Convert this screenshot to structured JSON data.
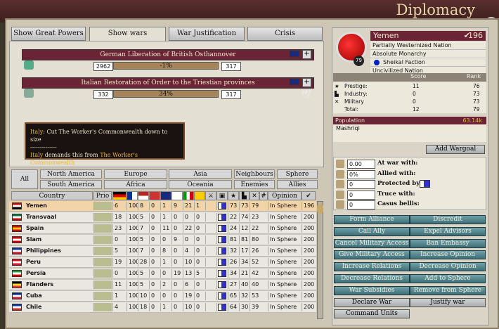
{
  "window": {
    "title": "Diplomacy",
    "close": "x"
  },
  "tabs": [
    "Show Great Powers",
    "Show wars",
    "War Justification",
    "Crisis"
  ],
  "wars": [
    {
      "name": "German Liberation of British Osthannover",
      "attacker_score": "2962",
      "war_score": "-1%",
      "defender_score": "317"
    },
    {
      "name": "Italian Restoration of Order to the Triestian provinces",
      "attacker_score": "332",
      "war_score": "34%",
      "defender_score": "317"
    }
  ],
  "demand": {
    "actor1": "Italy",
    "line1": ": Cut The Worker's Commonwealth down to size",
    "sep": "--------------",
    "actor2": "Italy",
    "line2": " demands this from ",
    "target": "The Worker's Commonwealth"
  },
  "filters": {
    "all": "All",
    "north_america": "North America",
    "south_america": "South America",
    "europe": "Europe",
    "africa": "Africa",
    "asia": "Asia",
    "oceania": "Oceania",
    "neighbours": "Neighbours",
    "enemies": "Enemies",
    "sphere": "Sphere",
    "allies": "Allies"
  },
  "table": {
    "headers": {
      "country": "Country",
      "prio": "Prio",
      "opinion": "Opinion",
      "num": "#"
    },
    "rows": [
      {
        "name": "Yemen",
        "vals": [
          "6",
          "100",
          "8",
          "0",
          "1",
          "9",
          "21",
          "1",
          "",
          "76",
          "73",
          "73",
          "79"
        ],
        "opinion": "In Sphere",
        "influence": "196",
        "flag": [
          "#c00",
          "#fff",
          "#000"
        ]
      },
      {
        "name": "Transvaal",
        "vals": [
          "18",
          "100",
          "5",
          "0",
          "1",
          "0",
          "0",
          "0",
          "",
          "17",
          "22",
          "74",
          "23"
        ],
        "opinion": "In Sphere",
        "influence": "200",
        "flag": [
          "#007a3d",
          "#fff",
          "#c00"
        ]
      },
      {
        "name": "Spain",
        "vals": [
          "23",
          "100",
          "7",
          "0",
          "11",
          "0",
          "22",
          "0",
          "",
          "75",
          "24",
          "12",
          "22"
        ],
        "opinion": "In Sphere",
        "influence": "200",
        "flag": [
          "#c60b1e",
          "#ffc400",
          "#c60b1e"
        ]
      },
      {
        "name": "Siam",
        "vals": [
          "0",
          "100",
          "5",
          "0",
          "0",
          "9",
          "0",
          "0",
          "",
          "80",
          "81",
          "81",
          "80"
        ],
        "opinion": "In Sphere",
        "influence": "200",
        "flag": [
          "#c00",
          "#fff",
          "#c00"
        ]
      },
      {
        "name": "Philippines",
        "vals": [
          "5",
          "100",
          "7",
          "0",
          "8",
          "0",
          "4",
          "0",
          "",
          "32",
          "32",
          "17",
          "26"
        ],
        "opinion": "In Sphere",
        "influence": "200",
        "flag": [
          "#0038a8",
          "#fff",
          "#ce1126"
        ]
      },
      {
        "name": "Peru",
        "vals": [
          "19",
          "100",
          "28",
          "0",
          "1",
          "0",
          "10",
          "0",
          "",
          "57",
          "26",
          "34",
          "52"
        ],
        "opinion": "In Sphere",
        "influence": "200",
        "flag": [
          "#d91023",
          "#fff",
          "#d91023"
        ]
      },
      {
        "name": "Persia",
        "vals": [
          "0",
          "100",
          "5",
          "0",
          "0",
          "19",
          "13",
          "5",
          "",
          "48",
          "34",
          "21",
          "42"
        ],
        "opinion": "In Sphere",
        "influence": "200",
        "flag": [
          "#239f40",
          "#fff",
          "#da0000"
        ]
      },
      {
        "name": "Flanders",
        "vals": [
          "11",
          "100",
          "5",
          "0",
          "2",
          "0",
          "6",
          "0",
          "",
          "31",
          "27",
          "40",
          "40"
        ],
        "opinion": "In Sphere",
        "influence": "200",
        "flag": [
          "#000",
          "#fdda24",
          "#ef3340"
        ]
      },
      {
        "name": "Cuba",
        "vals": [
          "1",
          "100",
          "10",
          "0",
          "0",
          "0",
          "19",
          "0",
          "",
          "46",
          "65",
          "32",
          "53"
        ],
        "opinion": "In Sphere",
        "influence": "200",
        "flag": [
          "#002a8f",
          "#fff",
          "#cf142b"
        ]
      },
      {
        "name": "Chile",
        "vals": [
          "4",
          "100",
          "18",
          "0",
          "1",
          "0",
          "10",
          "0",
          "",
          "27",
          "64",
          "30",
          "39"
        ],
        "opinion": "In Sphere",
        "influence": "200",
        "flag": [
          "#0039a6",
          "#fff",
          "#d52b1e"
        ]
      }
    ]
  },
  "country": {
    "name": "Yemen",
    "influence": "196",
    "rank_badge": "79",
    "type": "Partially Westernized Nation",
    "government": "Absolute Monarchy",
    "party": "Sheikal Faction",
    "civ": "Uncivilized Nation",
    "stats_headers": {
      "score": "Score",
      "rank": "Rank"
    },
    "stats": [
      {
        "label": "Prestige:",
        "score": "11",
        "rank": "76"
      },
      {
        "label": "Industry:",
        "score": "0",
        "rank": "73"
      },
      {
        "label": "Military",
        "score": "0",
        "rank": "73"
      },
      {
        "label": "Total:",
        "score": "12",
        "rank": "79"
      }
    ],
    "population_label": "Population",
    "population": "63.14k",
    "culture": "Mashriqi",
    "add_wargoal": "Add Wargoal",
    "relations": [
      {
        "value": "0.00",
        "label": "At war with:"
      },
      {
        "value": "0%",
        "label": "Allied with:"
      },
      {
        "value": "0",
        "label": "Protected by:"
      },
      {
        "value": "0",
        "label": "Truce with:"
      },
      {
        "value": "0",
        "label": "Casus bellis:"
      }
    ]
  },
  "actions": [
    [
      "Form Alliance",
      "Discredit"
    ],
    [
      "Call Ally",
      "Expel Advisors"
    ],
    [
      "Cancel Military Access",
      "Ban Embassy"
    ],
    [
      "Give Military Access",
      "Increase Opinion"
    ],
    [
      "Increase Relations",
      "Decrease Opinion"
    ],
    [
      "Decrease Relations",
      "Add to Sphere"
    ],
    [
      "War Subsidies",
      "Remove from Sphere"
    ],
    [
      "Declare War",
      "Justify war"
    ],
    [
      "Command Units",
      ""
    ]
  ]
}
